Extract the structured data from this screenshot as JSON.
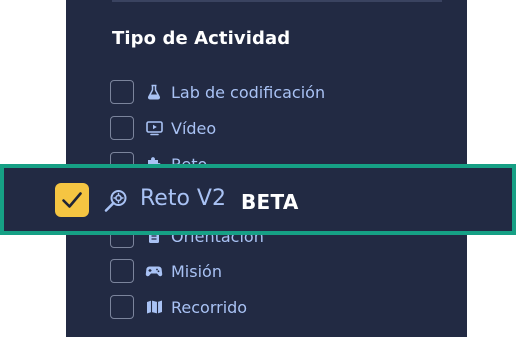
{
  "section": {
    "title": "Tipo de Actividad"
  },
  "items": [
    {
      "label": "Lab de codificación",
      "icon": "flask-icon",
      "checked": false
    },
    {
      "label": "Vídeo",
      "icon": "video-icon",
      "checked": false
    },
    {
      "label": "Reto",
      "icon": "puzzle-icon",
      "checked": false
    },
    {
      "label": "Orientación",
      "icon": "clipboard-icon",
      "checked": false
    },
    {
      "label": "Misión",
      "icon": "gamepad-icon",
      "checked": false
    },
    {
      "label": "Recorrido",
      "icon": "map-icon",
      "checked": false
    }
  ],
  "highlighted": {
    "label": "Reto V2",
    "badge": "BETA",
    "icon": "magnifier-icon",
    "checked": true
  },
  "colors": {
    "panel_bg": "#222a43",
    "label": "#a9c2f4",
    "checkbox_checked": "#f5c542",
    "highlight_border": "#16a085"
  }
}
